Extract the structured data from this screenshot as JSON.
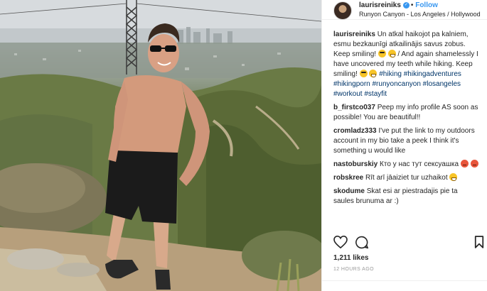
{
  "post": {
    "username": "laurisreiniks",
    "follow_label": "Follow",
    "dot": "•",
    "location": "Runyon Canyon - Los Angeles / Hollywood",
    "verified_icon": "verified-badge-icon"
  },
  "comments": [
    {
      "user": "laurisreiniks",
      "segments": [
        {
          "t": "Un atkal haikojot pa kalniem, esmu bezkaunīgi atkailinājis savus zobus. Keep smiling! "
        },
        {
          "emoji": "sunglasses-emoji"
        },
        {
          "t": " "
        },
        {
          "emoji": "grin-emoji"
        },
        {
          "t": " / And again shamelessly I have uncovered my teeth while hiking. Keep smiling! "
        },
        {
          "emoji": "sunglasses-emoji"
        },
        {
          "t": " "
        },
        {
          "emoji": "grin-emoji"
        },
        {
          "t": " "
        },
        {
          "tag": "#hiking"
        },
        {
          "t": " "
        },
        {
          "tag": "#hikingadventures"
        },
        {
          "t": " "
        },
        {
          "tag": "#hikingporn"
        },
        {
          "t": " "
        },
        {
          "tag": "#runyoncanyon"
        },
        {
          "t": " "
        },
        {
          "tag": "#losangeles"
        },
        {
          "t": " "
        },
        {
          "tag": "#workout"
        },
        {
          "t": " "
        },
        {
          "tag": "#stayfit"
        }
      ]
    },
    {
      "user": "b_firstco037",
      "segments": [
        {
          "t": "Peep my info profile AS soon as possible! You are beautiful!!"
        }
      ]
    },
    {
      "user": "cromladz333",
      "segments": [
        {
          "t": "I've put the link to my outdoors account in my bio take a peek I think it's something u would like"
        }
      ]
    },
    {
      "user": "nastoburskiy",
      "segments": [
        {
          "t": "Кто у нас тут сексуашка "
        },
        {
          "emoji": "angry-emoji"
        },
        {
          "t": " "
        },
        {
          "emoji": "angry-emoji"
        }
      ]
    },
    {
      "user": "robskree",
      "segments": [
        {
          "t": "Rīt arī jāaiziet tur uzhaikot "
        },
        {
          "emoji": "grin-emoji"
        }
      ]
    },
    {
      "user": "skodume",
      "segments": [
        {
          "t": "Skat esi ar piestradajis pie ta saules brunuma ar :)"
        }
      ]
    }
  ],
  "actions": {
    "like_icon": "heart-icon",
    "comment_icon": "comment-icon",
    "save_icon": "bookmark-icon"
  },
  "likes": "1,211 likes",
  "timestamp": "12 HOURS AGO",
  "colors": {
    "link": "#3897f0",
    "hashtag": "#003569",
    "text": "#262626",
    "muted": "#999999"
  }
}
